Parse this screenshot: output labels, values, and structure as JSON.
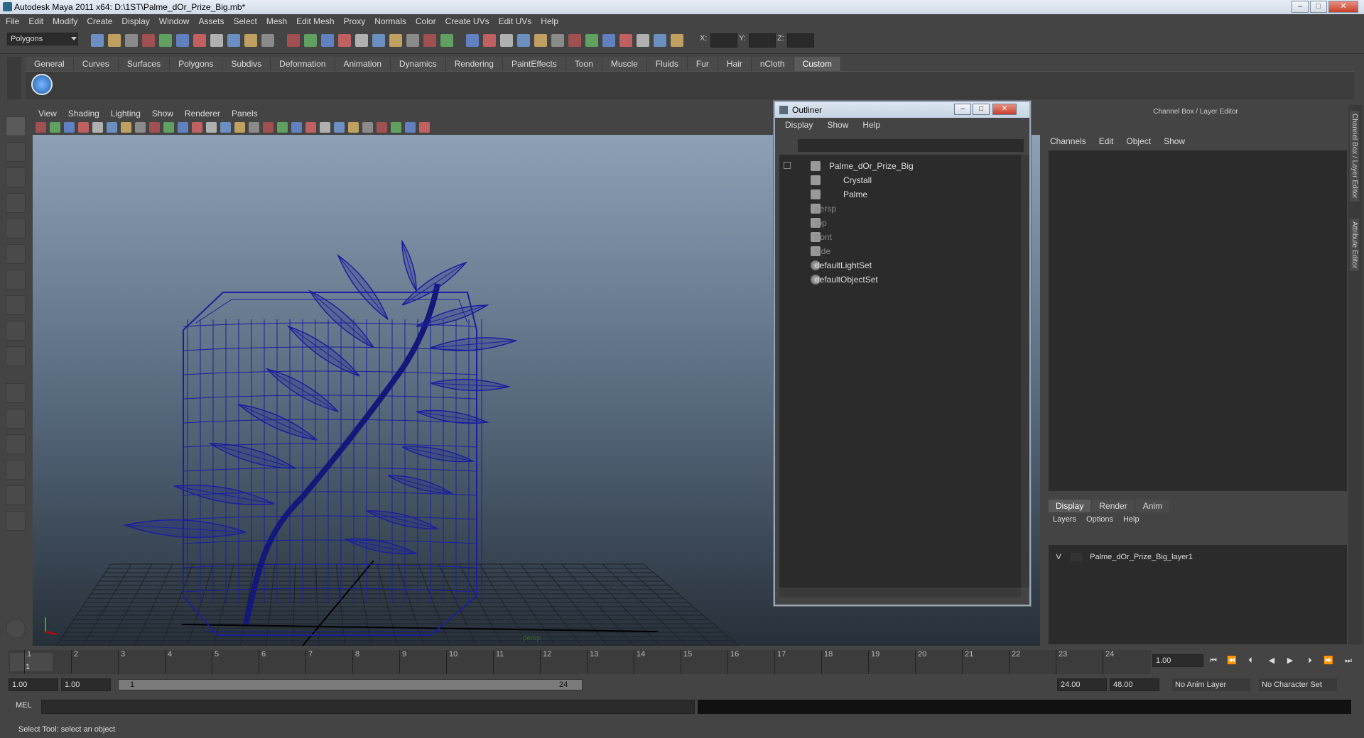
{
  "window": {
    "title": "Autodesk Maya 2011 x64: D:\\1ST\\Palme_dOr_Prize_Big.mb*",
    "minimize": "–",
    "maximize": "□",
    "close": "✕"
  },
  "menubar": [
    "File",
    "Edit",
    "Modify",
    "Create",
    "Display",
    "Window",
    "Assets",
    "Select",
    "Mesh",
    "Edit Mesh",
    "Proxy",
    "Normals",
    "Color",
    "Create UVs",
    "Edit UVs",
    "Help"
  ],
  "statusline": {
    "mode": "Polygons",
    "x_label": "X:",
    "y_label": "Y:",
    "z_label": "Z:"
  },
  "shelf_tabs": [
    "General",
    "Curves",
    "Surfaces",
    "Polygons",
    "Subdivs",
    "Deformation",
    "Animation",
    "Dynamics",
    "Rendering",
    "PaintEffects",
    "Toon",
    "Muscle",
    "Fluids",
    "Fur",
    "Hair",
    "nCloth",
    "Custom"
  ],
  "shelf_active_tab": "Custom",
  "viewport_menu": [
    "View",
    "Shading",
    "Lighting",
    "Show",
    "Renderer",
    "Panels"
  ],
  "viewport": {
    "camera_label": "persp",
    "wire_color": "#1a1f9e"
  },
  "outliner": {
    "title": "Outliner",
    "menu": [
      "Display",
      "Show",
      "Help"
    ],
    "items": [
      {
        "label": "Palme_dOr_Prize_Big",
        "dim": false
      },
      {
        "label": "Crystall",
        "dim": false
      },
      {
        "label": "Palme",
        "dim": false
      },
      {
        "label": "persp",
        "dim": true
      },
      {
        "label": "top",
        "dim": true
      },
      {
        "label": "front",
        "dim": true
      },
      {
        "label": "side",
        "dim": true
      },
      {
        "label": "defaultLightSet",
        "dim": false
      },
      {
        "label": "defaultObjectSet",
        "dim": false
      }
    ]
  },
  "channel_box": {
    "title": "Channel Box / Layer Editor",
    "menu": [
      "Channels",
      "Edit",
      "Object",
      "Show"
    ],
    "tabs": [
      "Display",
      "Render",
      "Anim"
    ],
    "active_tab": "Display",
    "layer_menu": [
      "Layers",
      "Options",
      "Help"
    ],
    "layers": [
      {
        "visible": "V",
        "name": "Palme_dOr_Prize_Big_layer1"
      }
    ]
  },
  "side_tabs": [
    "Channel Box / Layer Editor",
    "Attribute Editor"
  ],
  "timeslider": {
    "ticks": [
      "1",
      "2",
      "3",
      "4",
      "5",
      "6",
      "7",
      "8",
      "9",
      "10",
      "11",
      "12",
      "13",
      "14",
      "15",
      "16",
      "17",
      "18",
      "19",
      "20",
      "21",
      "22",
      "23",
      "24"
    ],
    "current_frame": "1",
    "current_time": "1.00"
  },
  "range": {
    "start": "1.00",
    "playback_start": "1.00",
    "slider_start": "1",
    "slider_end": "24",
    "playback_end": "24.00",
    "end": "48.00",
    "anim_layer": "No Anim Layer",
    "character_set": "No Character Set"
  },
  "cmdline": {
    "label": "MEL"
  },
  "helpline": "Select Tool: select an object"
}
